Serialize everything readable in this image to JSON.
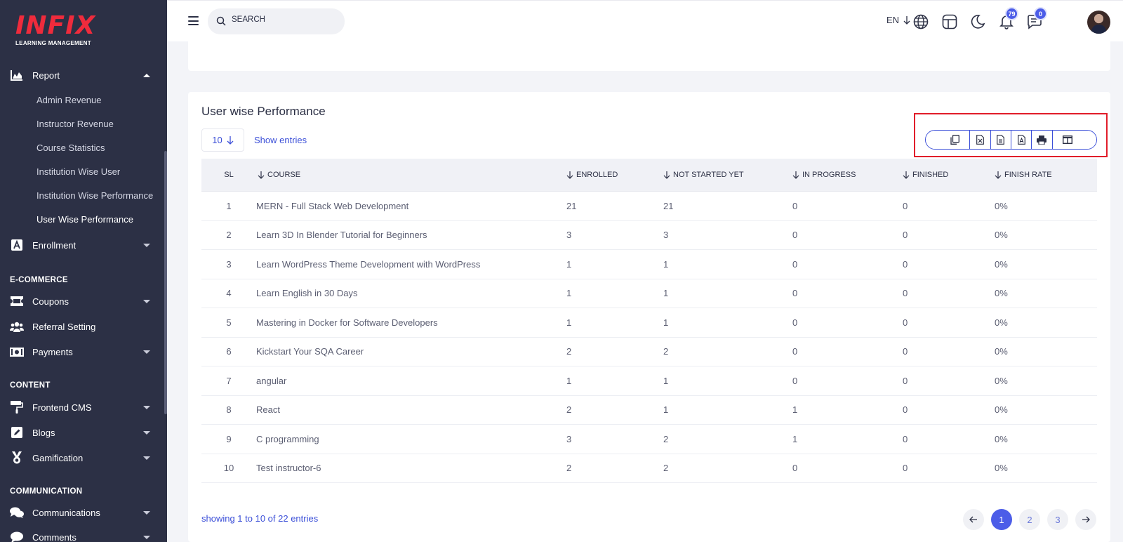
{
  "logo": {
    "mark": "INFIX",
    "subtitle": "LEARNING MANAGEMENT"
  },
  "sidebar": {
    "report": {
      "label": "Report",
      "icon": "chart-area-icon"
    },
    "report_items": [
      {
        "label": "Admin Revenue"
      },
      {
        "label": "Instructor Revenue"
      },
      {
        "label": "Course Statistics"
      },
      {
        "label": "Institution Wise User"
      },
      {
        "label": "Institution Wise Performance"
      },
      {
        "label": "User Wise Performance",
        "active": true
      }
    ],
    "enrollment": {
      "label": "Enrollment",
      "icon": "font-box-icon"
    },
    "sections": {
      "ecommerce": "E-COMMERCE",
      "content": "CONTENT",
      "communication": "COMMUNICATION"
    },
    "coupons": {
      "label": "Coupons",
      "icon": "ticket-icon"
    },
    "referral": {
      "label": "Referral Setting",
      "icon": "users-icon"
    },
    "payments": {
      "label": "Payments",
      "icon": "money-bill-icon"
    },
    "frontend_cms": {
      "label": "Frontend CMS",
      "icon": "paint-roller-icon"
    },
    "blogs": {
      "label": "Blogs",
      "icon": "pen-square-icon"
    },
    "gamification": {
      "label": "Gamification",
      "icon": "medal-icon"
    },
    "communications": {
      "label": "Communications",
      "icon": "comments-icon"
    },
    "comments": {
      "label": "Comments",
      "icon": "comment-icon"
    }
  },
  "topbar": {
    "search_placeholder": "SEARCH",
    "language": "EN",
    "notifications_count": "79",
    "messages_count": "0",
    "icons": [
      "globe-icon",
      "layout-icon",
      "moon-icon",
      "bell-icon",
      "chat-icon"
    ]
  },
  "card": {
    "title": "User wise Performance",
    "page_length": "10",
    "show_entries": "Show entries",
    "export_buttons": [
      "copy-icon",
      "excel-icon",
      "csv-icon",
      "pdf-icon",
      "print-icon",
      "columns-icon"
    ]
  },
  "table": {
    "headers": {
      "sl": "SL",
      "course": "COURSE",
      "enrolled": "ENROLLED",
      "not_started": "NOT STARTED YET",
      "in_progress": "IN PROGRESS",
      "finished": "FINISHED",
      "finish_rate": "FINISH RATE"
    },
    "rows": [
      {
        "sl": "1",
        "course": "MERN - Full Stack Web Development",
        "enrolled": "21",
        "not_started": "21",
        "in_progress": "0",
        "finished": "0",
        "finish_rate": "0%"
      },
      {
        "sl": "2",
        "course": "Learn 3D In Blender Tutorial for Beginners",
        "enrolled": "3",
        "not_started": "3",
        "in_progress": "0",
        "finished": "0",
        "finish_rate": "0%"
      },
      {
        "sl": "3",
        "course": "Learn WordPress Theme Development with WordPress",
        "enrolled": "1",
        "not_started": "1",
        "in_progress": "0",
        "finished": "0",
        "finish_rate": "0%"
      },
      {
        "sl": "4",
        "course": "Learn English in 30 Days",
        "enrolled": "1",
        "not_started": "1",
        "in_progress": "0",
        "finished": "0",
        "finish_rate": "0%"
      },
      {
        "sl": "5",
        "course": "Mastering in Docker for Software Developers",
        "enrolled": "1",
        "not_started": "1",
        "in_progress": "0",
        "finished": "0",
        "finish_rate": "0%"
      },
      {
        "sl": "6",
        "course": "Kickstart Your SQA Career",
        "enrolled": "2",
        "not_started": "2",
        "in_progress": "0",
        "finished": "0",
        "finish_rate": "0%"
      },
      {
        "sl": "7",
        "course": "angular",
        "enrolled": "1",
        "not_started": "1",
        "in_progress": "0",
        "finished": "0",
        "finish_rate": "0%"
      },
      {
        "sl": "8",
        "course": "React",
        "enrolled": "2",
        "not_started": "1",
        "in_progress": "1",
        "finished": "0",
        "finish_rate": "0%"
      },
      {
        "sl": "9",
        "course": "C programming",
        "enrolled": "3",
        "not_started": "2",
        "in_progress": "1",
        "finished": "0",
        "finish_rate": "0%"
      },
      {
        "sl": "10",
        "course": "Test instructor-6",
        "enrolled": "2",
        "not_started": "2",
        "in_progress": "0",
        "finished": "0",
        "finish_rate": "0%"
      }
    ]
  },
  "footer": {
    "showing": "showing 1 to 10 of 22 entries",
    "pages": [
      "1",
      "2",
      "3"
    ],
    "active_page": "1"
  }
}
